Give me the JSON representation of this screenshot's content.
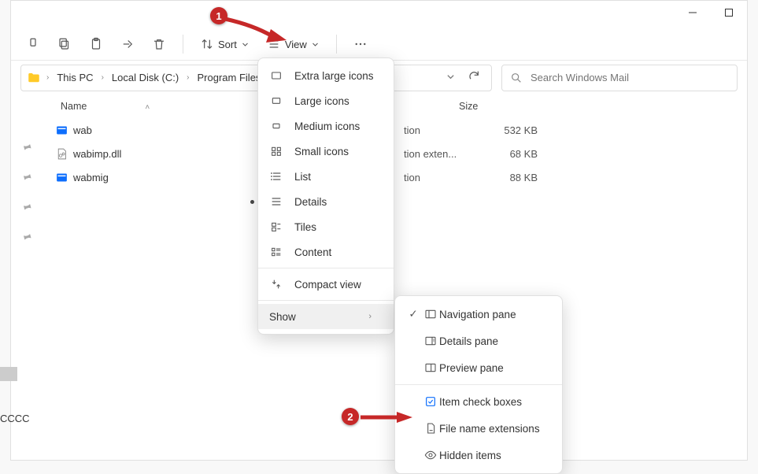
{
  "toolbar": {
    "sort_label": "Sort",
    "view_label": "View"
  },
  "breadcrumbs": {
    "b0": "This PC",
    "b1": "Local Disk (C:)",
    "b2": "Program Files"
  },
  "search": {
    "placeholder": "Search Windows Mail"
  },
  "columns": {
    "name": "Name",
    "size": "Size"
  },
  "files": {
    "r0": {
      "name": "wab",
      "type": "tion",
      "size": "532 KB"
    },
    "r1": {
      "name": "wabimp.dll",
      "type": "tion exten...",
      "size": "68 KB"
    },
    "r2": {
      "name": "wabmig",
      "type": "tion",
      "size": "88 KB"
    }
  },
  "view_menu": {
    "xl": "Extra large icons",
    "lg": "Large icons",
    "md": "Medium icons",
    "sm": "Small icons",
    "list": "List",
    "details": "Details",
    "tiles": "Tiles",
    "content": "Content",
    "compact": "Compact view",
    "show": "Show"
  },
  "show_menu": {
    "nav": "Navigation pane",
    "details": "Details pane",
    "preview": "Preview pane",
    "checkboxes": "Item check boxes",
    "ext": "File name extensions",
    "hidden": "Hidden items"
  },
  "annotation": {
    "b1": "1",
    "b2": "2"
  },
  "bl": "CCCC"
}
